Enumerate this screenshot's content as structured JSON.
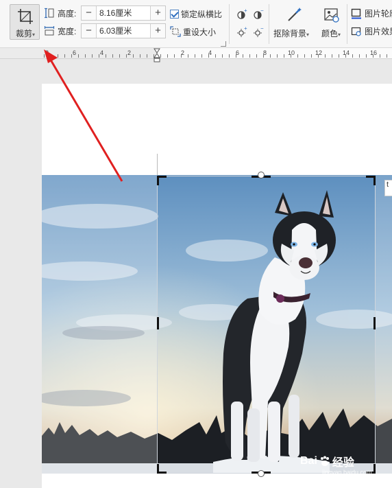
{
  "toolbar": {
    "crop_label": "裁剪",
    "height_label": "高度:",
    "height_value": "8.16厘米",
    "width_label": "宽度:",
    "width_value": "6.03厘米",
    "minus": "−",
    "plus": "+",
    "lock_ratio_label": "锁定纵横比",
    "reset_size_label": "重设大小",
    "remove_bg_label": "抠除背景",
    "color_label": "颜色",
    "outline_label": "图片轮廓",
    "effects_label": "图片效果"
  },
  "ruler": {
    "left_numbers": [
      "8",
      "6",
      "4",
      "2"
    ],
    "right_numbers": [
      "2",
      "4",
      "6",
      "8",
      "10",
      "12",
      "14",
      "16"
    ]
  },
  "canvas": {
    "float_tab": "t"
  },
  "watermark": {
    "brand_a": "Bai",
    "brand_b": "经验",
    "url": "jingyan.baidu.com"
  },
  "colors": {
    "annotation_arrow": "#e02020",
    "crop_handle": "#111111",
    "accent_blue": "#2f6fc0"
  }
}
